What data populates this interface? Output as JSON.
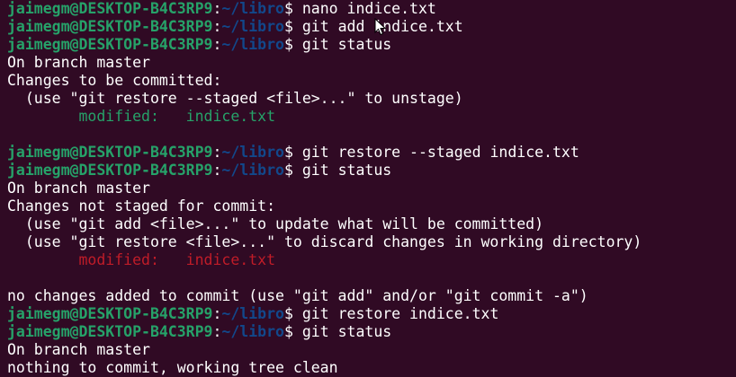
{
  "colors": {
    "background": "#300a24",
    "user_host": "#26a269",
    "path": "#12488b",
    "text": "#ffffff",
    "staged": "#26a269",
    "unstaged": "#c01c28"
  },
  "prompt": {
    "user_host": "jaimegm@DESKTOP-B4C3RP9",
    "colon": ":",
    "path": "~/libro",
    "symbol": "$ "
  },
  "terminal": {
    "lines": [
      {
        "type": "prompt",
        "command": "nano indice.txt"
      },
      {
        "type": "prompt",
        "command": "git add indice.txt"
      },
      {
        "type": "prompt",
        "command": "git status"
      },
      {
        "type": "text",
        "text": "On branch master"
      },
      {
        "type": "text",
        "text": "Changes to be committed:"
      },
      {
        "type": "text",
        "text": "  (use \"git restore --staged <file>...\" to unstage)"
      },
      {
        "type": "colored",
        "color": "staged",
        "text": "        modified:   indice.txt"
      },
      {
        "type": "text",
        "text": ""
      },
      {
        "type": "prompt",
        "command": "git restore --staged indice.txt"
      },
      {
        "type": "prompt",
        "command": "git status"
      },
      {
        "type": "text",
        "text": "On branch master"
      },
      {
        "type": "text",
        "text": "Changes not staged for commit:"
      },
      {
        "type": "text",
        "text": "  (use \"git add <file>...\" to update what will be committed)"
      },
      {
        "type": "text",
        "text": "  (use \"git restore <file>...\" to discard changes in working directory)"
      },
      {
        "type": "colored",
        "color": "unstaged",
        "text": "        modified:   indice.txt"
      },
      {
        "type": "text",
        "text": ""
      },
      {
        "type": "text",
        "text": "no changes added to commit (use \"git add\" and/or \"git commit -a\")"
      },
      {
        "type": "prompt",
        "command": "git restore indice.txt"
      },
      {
        "type": "prompt",
        "command": "git status"
      },
      {
        "type": "text",
        "text": "On branch master"
      },
      {
        "type": "text",
        "text": "nothing to commit, working tree clean"
      }
    ]
  },
  "mouse_cursor_icon": "arrow-cursor-icon"
}
